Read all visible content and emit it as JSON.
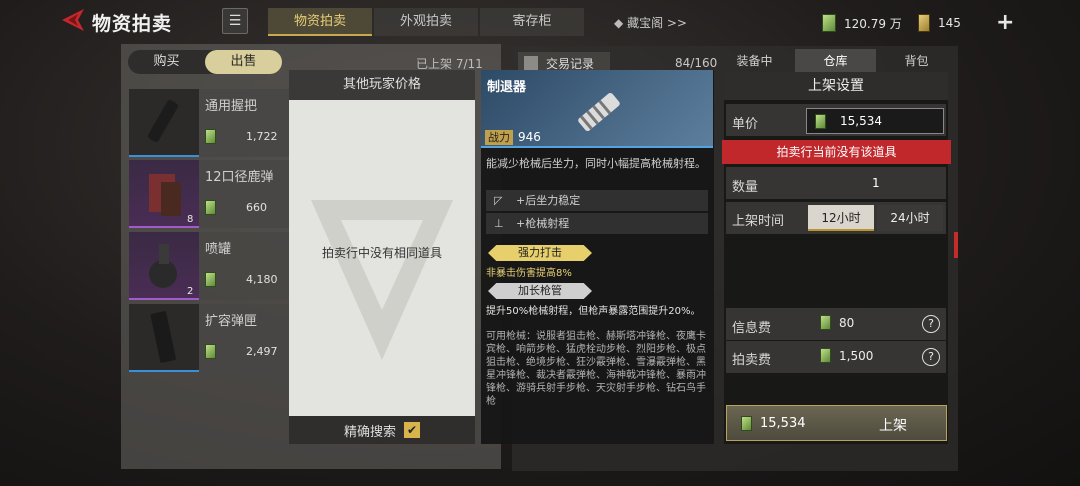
{
  "header": {
    "title": "物资拍卖",
    "tabs": [
      {
        "label": "物资拍卖",
        "active": true
      },
      {
        "label": "外观拍卖",
        "active": false
      },
      {
        "label": "寄存柜",
        "active": false
      }
    ],
    "treasure_link": "藏宝阁 >>",
    "currency_bills": "120.79 万",
    "currency_tickets": "145",
    "plus": "+"
  },
  "left": {
    "buy_label": "购买",
    "sell_label": "出售",
    "listed": "已上架 7/11",
    "items": [
      {
        "name": "通用握把",
        "price": "1,722",
        "qty": "",
        "rarity": "blue"
      },
      {
        "name": "12口径鹿弹",
        "price": "660",
        "qty": "8",
        "rarity": "purple"
      },
      {
        "name": "喷罐",
        "price": "4,180",
        "qty": "2",
        "rarity": "purple"
      },
      {
        "name": "扩容弹匣",
        "price": "2,497",
        "qty": "",
        "rarity": "blue"
      }
    ]
  },
  "others": {
    "title": "其他玩家价格",
    "empty": "拍卖行中没有相同道具",
    "exact_search": "精确搜索",
    "exact_checked": "✔"
  },
  "detail": {
    "name": "制退器",
    "power_label": "战力",
    "power_value": "946",
    "description": "能减少枪械后坐力，同时小幅提高枪械射程。",
    "attrs": [
      "+后坐力稳定",
      "+枪械射程"
    ],
    "perks": [
      {
        "name": "强力打击",
        "desc": "非暴击伤害提高8%",
        "style": "gold"
      },
      {
        "name": "加长枪管",
        "desc": "提升50%枪械射程，但枪声暴露范围提升20%。",
        "style": "silver"
      }
    ],
    "compatible": "可用枪械：说服者狙击枪、赫斯塔冲锋枪、夜鹰卡宾枪、响箭步枪、猛虎栓动步枪、烈阳步枪、极点狙击枪、绝境步枪、狂沙霰弹枪、雪瀑霰弹枪、黑星冲锋枪、裁决者霰弹枪、海神戟冲锋枪、暴雨冲锋枪、游骑兵射手步枪、天灾射手步枪、钻石鸟手枪"
  },
  "right": {
    "trade_log": "交易记录",
    "slot_count": "84/160",
    "side_tabs": [
      {
        "label": "装备中",
        "active": false
      },
      {
        "label": "仓库",
        "active": true
      },
      {
        "label": "背包",
        "active": false
      }
    ]
  },
  "settings": {
    "title": "上架设置",
    "unit_price_label": "单价",
    "unit_price": "15,534",
    "warning": "拍卖行当前没有该道具",
    "quantity_label": "数量",
    "quantity": "1",
    "time_label": "上架时间",
    "time_options": [
      {
        "label": "12小时",
        "active": true
      },
      {
        "label": "24小时",
        "active": false
      }
    ],
    "info_fee_label": "信息费",
    "info_fee": "80",
    "auction_fee_label": "拍卖费",
    "auction_fee": "1,500",
    "total": "15,534",
    "list_button": "上架"
  }
}
